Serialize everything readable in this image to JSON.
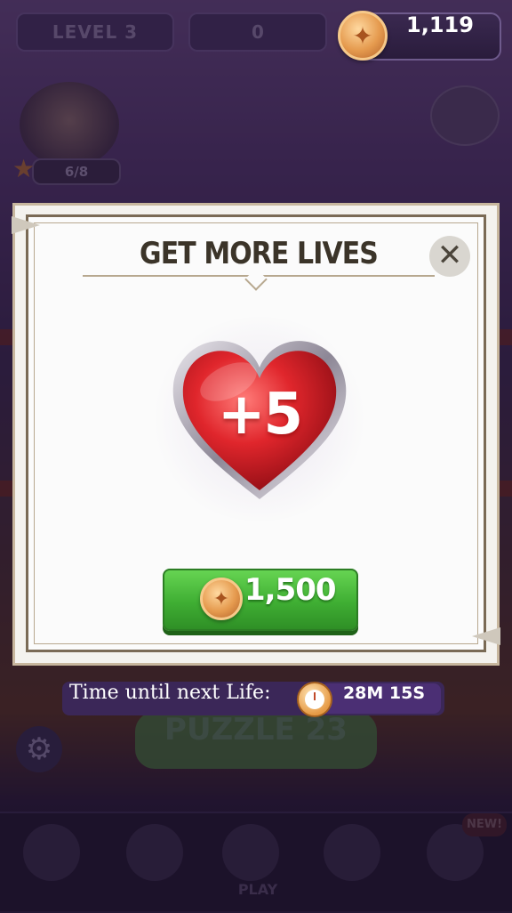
{
  "background": {
    "level_label": "LEVEL 3",
    "mid_label": "0",
    "progress_label": "6/8",
    "puzzle_label": "PUZZLE 23",
    "play_label": "PLAY",
    "new_badge": "NEW!"
  },
  "header": {
    "coins": "1,119"
  },
  "modal": {
    "title": "GET MORE LIVES",
    "close_icon": "close-icon",
    "reward_text": "+5",
    "price": "1,500"
  },
  "timer": {
    "label": "Time until next Life:",
    "value": "28M 15S"
  },
  "colors": {
    "buy_button": "#3fae33",
    "heart": "#d8232b",
    "timer_bg": "#3b2758"
  }
}
